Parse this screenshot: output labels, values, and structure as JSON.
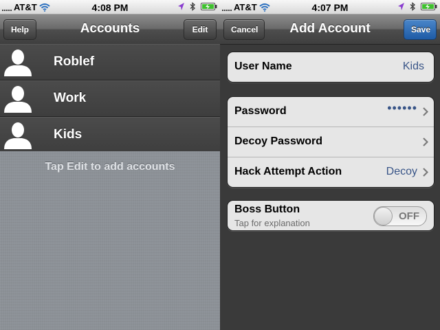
{
  "left": {
    "status": {
      "carrier": "AT&T",
      "time": "4:08 PM"
    },
    "nav": {
      "title": "Accounts",
      "left_button": "Help",
      "right_button": "Edit"
    },
    "accounts": [
      {
        "name": "Roblef",
        "icon": "person-silhouette-icon"
      },
      {
        "name": "Work",
        "icon": "person-silhouette-icon"
      },
      {
        "name": "Kids",
        "icon": "person-silhouette-icon"
      }
    ],
    "hint": "Tap Edit to add accounts"
  },
  "right": {
    "status": {
      "carrier": "AT&T",
      "time": "4:07 PM"
    },
    "nav": {
      "title": "Add Account",
      "left_button": "Cancel",
      "right_button": "Save"
    },
    "username": {
      "label": "User Name",
      "value": "Kids"
    },
    "password": {
      "label": "Password",
      "value": "••••••"
    },
    "decoy": {
      "label": "Decoy Password"
    },
    "hack": {
      "label": "Hack Attempt Action",
      "value": "Decoy"
    },
    "boss": {
      "label": "Boss Button",
      "subtitle": "Tap for explanation",
      "toggle": "OFF"
    }
  },
  "colors": {
    "save_button": "#1e5ba6",
    "cell_value": "#385487",
    "location_arrow": "#8a3ccf",
    "battery": "#3fbf2f"
  }
}
